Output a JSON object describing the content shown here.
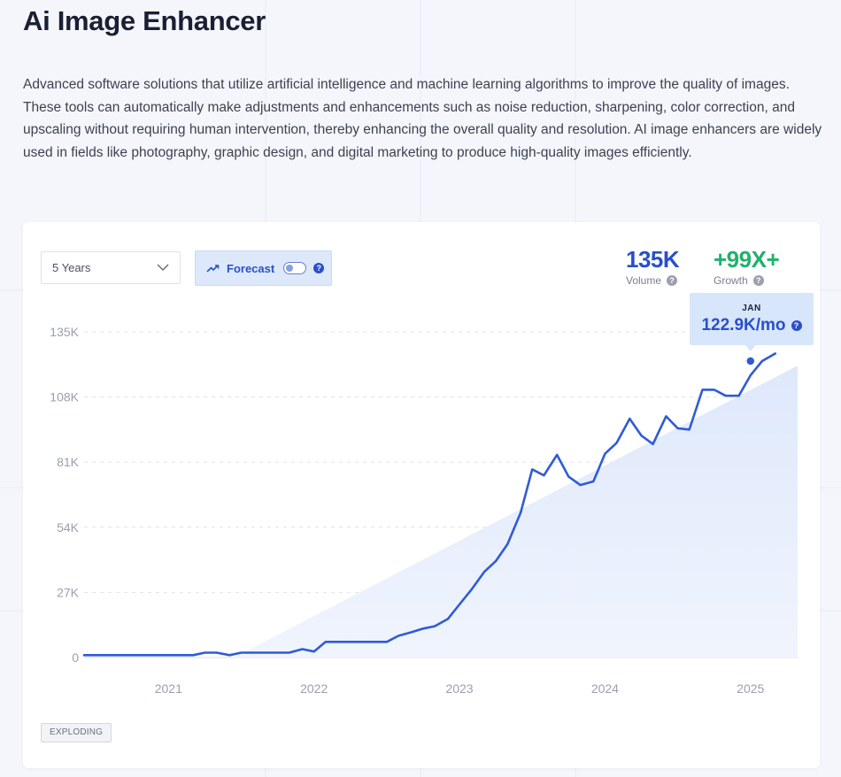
{
  "title": "Ai Image Enhancer",
  "description": "Advanced software solutions that utilize artificial intelligence and machine learning algorithms to improve the quality of images. These tools can automatically make adjustments and enhancements such as noise reduction, sharpening, color correction, and upscaling without requiring human intervention, thereby enhancing the overall quality and resolution. AI image enhancers are widely used in fields like photography, graphic design, and digital marketing to produce high-quality images efficiently.",
  "controls": {
    "range_select": "5 Years",
    "forecast_label": "Forecast",
    "forecast_enabled": false
  },
  "stats": {
    "volume_value": "135K",
    "volume_label": "Volume",
    "growth_value": "+99X+",
    "growth_label": "Growth"
  },
  "tooltip": {
    "month": "JAN",
    "value": "122.9K/mo"
  },
  "badge": "EXPLODING",
  "colors": {
    "line": "#2f5bd8",
    "growth": "#20b26b",
    "accent": "#2a4fc9"
  },
  "chart_data": {
    "type": "line",
    "title": "",
    "xlabel": "",
    "ylabel": "",
    "ylim": [
      0,
      135000
    ],
    "yticks": [
      0,
      27000,
      54000,
      81000,
      108000,
      135000
    ],
    "ytick_labels": [
      "0",
      "27K",
      "54K",
      "81K",
      "108K",
      "135K"
    ],
    "xticks": [
      2021,
      2022,
      2023,
      2024,
      2025
    ],
    "xtick_labels": [
      "2021",
      "2022",
      "2023",
      "2024",
      "2025"
    ],
    "grid": true,
    "series": [
      {
        "x": [
          2020.42,
          2020.5,
          2020.58,
          2020.67,
          2020.75,
          2020.83,
          2020.92,
          2021.0,
          2021.08,
          2021.17,
          2021.25,
          2021.33,
          2021.42,
          2021.5,
          2021.58,
          2021.67,
          2021.75,
          2021.83,
          2021.92,
          2022.0,
          2022.08,
          2022.17,
          2022.25,
          2022.33,
          2022.42,
          2022.5,
          2022.58,
          2022.67,
          2022.75,
          2022.83,
          2022.92,
          2023.0,
          2023.08,
          2023.17,
          2023.25,
          2023.33,
          2023.42,
          2023.5,
          2023.58,
          2023.67,
          2023.75,
          2023.83,
          2023.92,
          2024.0,
          2024.08,
          2024.17,
          2024.25,
          2024.33,
          2024.42,
          2024.5,
          2024.58,
          2024.67,
          2024.75,
          2024.83,
          2024.92,
          2025.0,
          2025.08,
          2025.17
        ],
        "values": [
          1000,
          1000,
          1000,
          1000,
          1000,
          1000,
          1000,
          1000,
          1000,
          1000,
          2000,
          2000,
          1000,
          2000,
          2000,
          2000,
          2000,
          2000,
          3500,
          2500,
          6500,
          6500,
          6500,
          6500,
          6500,
          6500,
          9000,
          10500,
          12000,
          13000,
          16000,
          22000,
          28000,
          35500,
          40000,
          47000,
          60000,
          78000,
          75500,
          84000,
          75000,
          71500,
          73000,
          84500,
          89000,
          99000,
          92000,
          88500,
          100000,
          95000,
          94500,
          111000,
          111000,
          108500,
          108500,
          117000,
          122900,
          126000
        ]
      }
    ],
    "forecast_area": {
      "x": [
        2021.45,
        2025.33
      ],
      "values": [
        0,
        121000
      ]
    },
    "highlight": {
      "x": 2025.0,
      "value": 122900,
      "label": "JAN"
    }
  }
}
